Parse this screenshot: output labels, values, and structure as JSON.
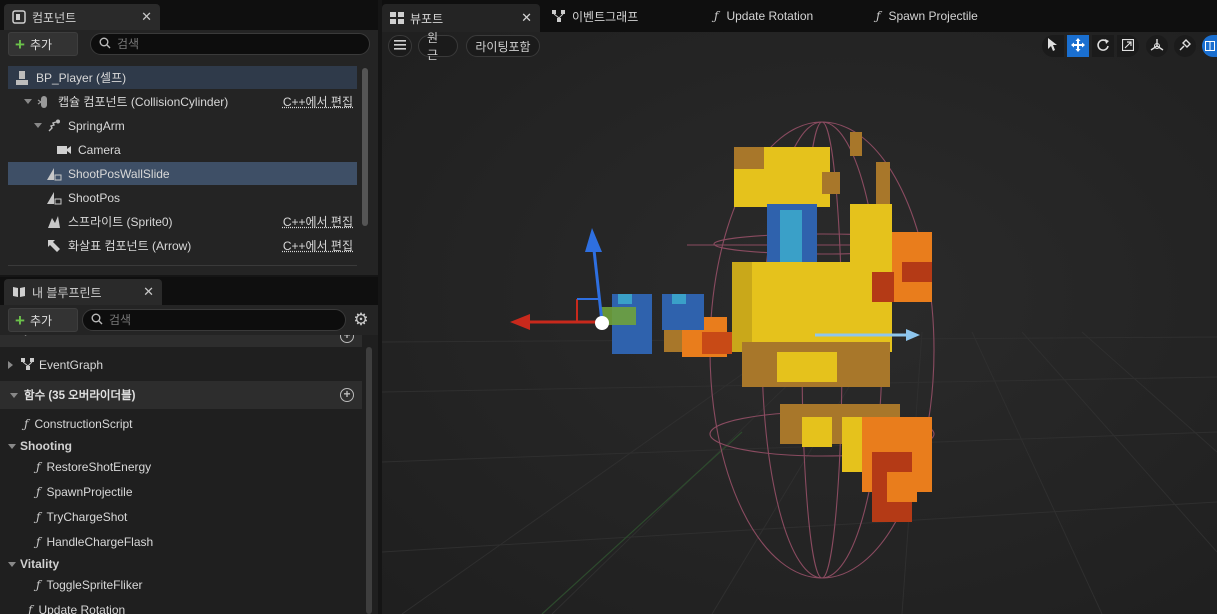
{
  "components_panel": {
    "tab_label": "컴포넌트",
    "add_label": "추가",
    "search_placeholder": "검색",
    "items": [
      {
        "label": "BP_Player (셀프)",
        "cpp": ""
      },
      {
        "label": "캡슐 컴포넌트 (CollisionCylinder)",
        "cpp": "C++에서 편집"
      },
      {
        "label": "SpringArm",
        "cpp": ""
      },
      {
        "label": "Camera",
        "cpp": ""
      },
      {
        "label": "ShootPosWallSlide",
        "cpp": ""
      },
      {
        "label": "ShootPos",
        "cpp": ""
      },
      {
        "label": "스프라이트 (Sprite0)",
        "cpp": "C++에서 편집"
      },
      {
        "label": "화살표 컴포넌트 (Arrow)",
        "cpp": "C++에서 편집"
      }
    ]
  },
  "blueprint_panel": {
    "tab_label": "내 블루프린트",
    "add_label": "추가",
    "search_placeholder": "검색",
    "graphs_label": "그래프",
    "event_graph": "EventGraph",
    "functions_label": "함수 (35 오버라이더블)",
    "construction_script": "ConstructionScript",
    "shooting_label": "Shooting",
    "shooting_items": [
      "RestoreShotEnergy",
      "SpawnProjectile",
      "TryChargeShot",
      "HandleChargeFlash"
    ],
    "vitality_label": "Vitality",
    "vitality_items": [
      "ToggleSpriteFliker"
    ],
    "update_rotation": "Update Rotation"
  },
  "doc_tabs": {
    "viewport": "뷰포트",
    "event_graph": "이벤트그래프",
    "update_rotation": "Update Rotation",
    "spawn_projectile": "Spawn Projectile"
  },
  "viewport": {
    "perspective": "원근",
    "lighting": "라이팅포함"
  },
  "colors": {
    "selection": "#3e4f66",
    "tool_active": "#1a6fd0",
    "add_plus": "#6bc24a",
    "sprite_yellow": "#e5c21c",
    "sprite_orange": "#e97d1c",
    "sprite_blue": "#2f62ad"
  }
}
